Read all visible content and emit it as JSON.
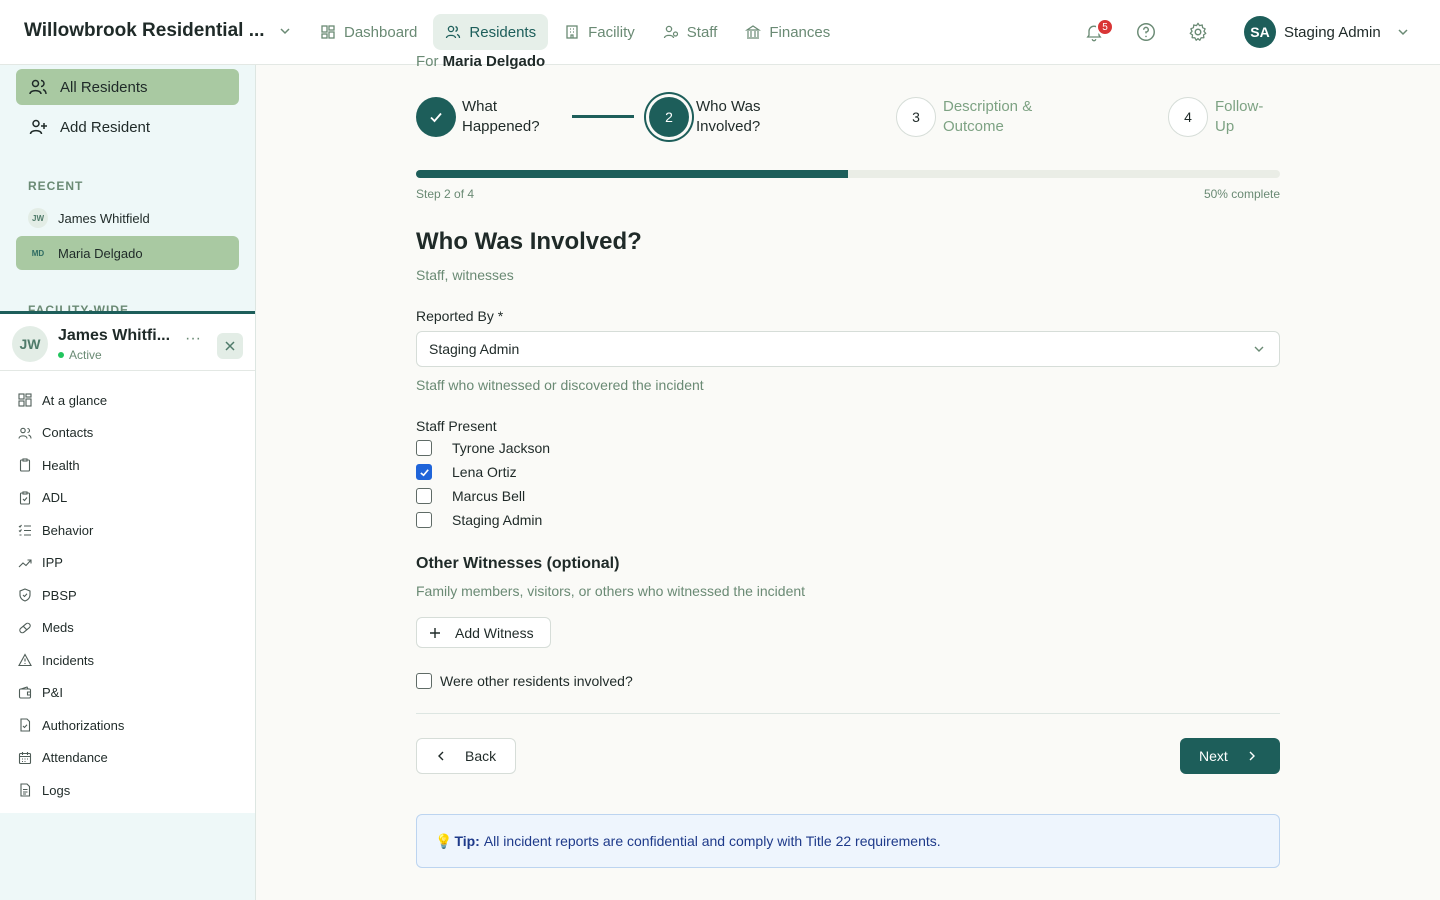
{
  "header": {
    "brand_title": "Willowbrook Residential ...",
    "nav": [
      {
        "label": "Dashboard",
        "icon": "dashboard-icon"
      },
      {
        "label": "Residents",
        "icon": "users-icon"
      },
      {
        "label": "Facility",
        "icon": "building-icon"
      },
      {
        "label": "Staff",
        "icon": "staff-icon"
      },
      {
        "label": "Finances",
        "icon": "bank-icon"
      }
    ],
    "notification_count": "5",
    "user_initials": "SA",
    "user_name": "Staging Admin"
  },
  "sidebar": {
    "items": [
      {
        "label": "All Residents"
      },
      {
        "label": "Add Resident"
      }
    ],
    "recent_label": "RECENT",
    "recent": [
      {
        "initials": "JW",
        "name": "James Whitfield"
      },
      {
        "initials": "MD",
        "name": "Maria Delgado"
      }
    ],
    "facility_label": "FACILITY-WIDE"
  },
  "resident_panel": {
    "initials": "JW",
    "name": "James Whitfi...",
    "status": "Active",
    "more": "···",
    "menu": [
      {
        "label": "At a glance"
      },
      {
        "label": "Contacts"
      },
      {
        "label": "Health"
      },
      {
        "label": "ADL"
      },
      {
        "label": "Behavior"
      },
      {
        "label": "IPP"
      },
      {
        "label": "PBSP"
      },
      {
        "label": "Meds"
      },
      {
        "label": "Incidents"
      },
      {
        "label": "P&I"
      },
      {
        "label": "Authorizations"
      },
      {
        "label": "Attendance"
      },
      {
        "label": "Logs"
      }
    ]
  },
  "main": {
    "breadcrumb_prefix": "For",
    "breadcrumb_name": "Maria Delgado",
    "steps": [
      {
        "number": "1",
        "line1": "What",
        "line2": "Happened?"
      },
      {
        "number": "2",
        "line1": "Who Was",
        "line2": "Involved?"
      },
      {
        "number": "3",
        "line1": "Description &",
        "line2": "Outcome"
      },
      {
        "number": "4",
        "line1": "Follow-",
        "line2": "Up"
      }
    ],
    "progress_fraction": 0.5,
    "progress_step_text": "Step 2 of 4",
    "progress_percent_text": "50% complete",
    "title": "Who Was Involved?",
    "subtitle": "Staff, witnesses",
    "reported_by_label": "Reported By *",
    "reported_by_value": "Staging Admin",
    "reported_by_help": "Staff who witnessed or discovered the incident",
    "staff_present_label": "Staff Present",
    "staff_present": [
      {
        "name": "Tyrone Jackson",
        "checked": false
      },
      {
        "name": "Lena Ortiz",
        "checked": true
      },
      {
        "name": "Marcus Bell",
        "checked": false
      },
      {
        "name": "Staging Admin",
        "checked": false
      }
    ],
    "other_witnesses_title": "Other Witnesses (optional)",
    "other_witnesses_help": "Family members, visitors, or others who witnessed the incident",
    "add_witness_label": "Add Witness",
    "other_residents_label": "Were other residents involved?",
    "back_label": "Back",
    "next_label": "Next",
    "tip_icon": "💡",
    "tip_label": "Tip:",
    "tip_text": "All incident reports are confidential and comply with Title 22 requirements."
  },
  "colors": {
    "accent": "#1d5e5a",
    "active_sidebar": "#a9c9a2",
    "muted_text": "#6a8a74",
    "checkbox_checked": "#1f64d9",
    "badge": "#d93636"
  }
}
